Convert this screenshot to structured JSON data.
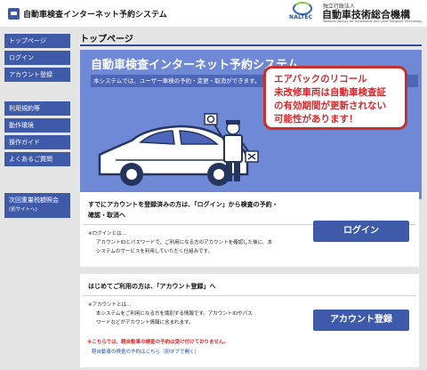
{
  "header": {
    "app_title": "自動車検査インターネット予約システム",
    "org_small": "独立行政法人",
    "org_name": "自動車技術総合機構",
    "org_en": "National Agency for Automobile and Land Transport Technology",
    "org_logo_text": "NALTEC"
  },
  "sidebar": {
    "items": [
      {
        "label": "トップページ"
      },
      {
        "label": "ログイン"
      },
      {
        "label": "アカウント登録"
      },
      {
        "label": "利用規約等"
      },
      {
        "label": "動作環境"
      },
      {
        "label": "操作ガイド"
      },
      {
        "label": "よくあるご質問"
      },
      {
        "label": "次回重量税額照会",
        "sub": "(別サイトへ)"
      }
    ]
  },
  "main": {
    "page_title": "トップページ",
    "banner": {
      "title": "自動車検査インターネット予約システム",
      "subtitle": "本システムでは、ユーザー車検の予約・変更・取消ができます。",
      "recall_lines": [
        "エアバックのリコール",
        "未改修車両は自動車検査証",
        "の有効期間が更新されない",
        "可能性があります！"
      ]
    },
    "login_card": {
      "heading_line1": "すでにアカウントを登録済みの方は、「ログイン」から検査の予約・",
      "heading_line2": "確認・取消へ",
      "note_line1": "※ログインとは…",
      "note_line2": "アカウントIDとパスワードで、ご利用になる方のアカウントを確認した後に、本",
      "note_line3": "システムのサービスを利用していただく仕組みです。",
      "button_label": "ログイン"
    },
    "register_card": {
      "heading": "はじめてご利用の方は、「アカウント登録」へ",
      "note_line1": "※アカウントとは…",
      "note_line2": "本システムをご利用になる方を識別する情報です。アカウントIDやパス",
      "note_line3": "ワードなどがアカウント情報に含まれます。",
      "button_label": "アカウント登録",
      "warning": "※こちらでは、軽自動車の検査の予約は受け付けておりません。",
      "link_text": "軽自動車の検査の予約はこちら（別タブで開く）"
    }
  },
  "colors": {
    "accent": "#3e5aa8",
    "banner": "#6f89d6",
    "alert_red": "#d8262a",
    "sidebar_bg": "#e5e5e5"
  }
}
